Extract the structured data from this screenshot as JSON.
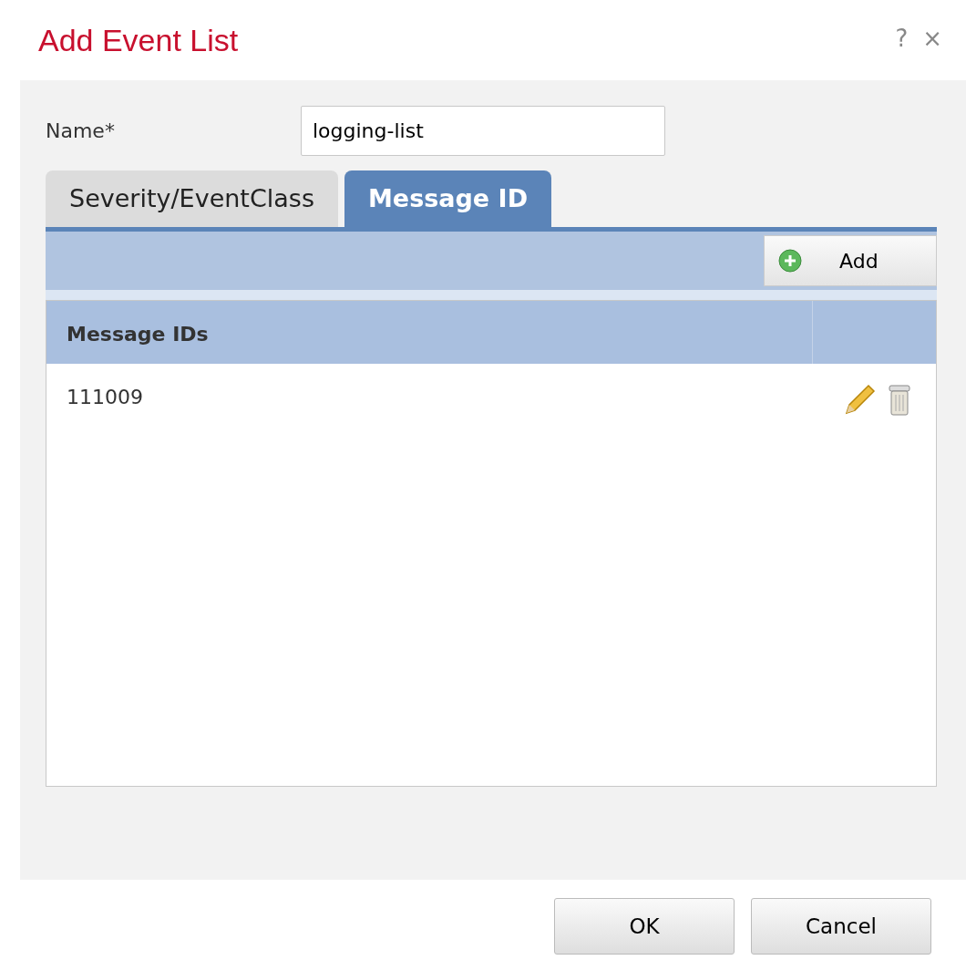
{
  "dialog": {
    "title": "Add Event List",
    "help": "?",
    "close": "×"
  },
  "name_field": {
    "label": "Name*",
    "value": "logging-list"
  },
  "tabs": [
    {
      "label": "Severity/EventClass",
      "selected": false
    },
    {
      "label": "Message ID",
      "selected": true
    }
  ],
  "toolbar": {
    "add_button": "Add"
  },
  "table": {
    "columns": [
      "Message IDs"
    ],
    "rows": [
      {
        "message_id": "111009"
      }
    ]
  },
  "buttons": [
    "OK",
    "Cancel"
  ]
}
